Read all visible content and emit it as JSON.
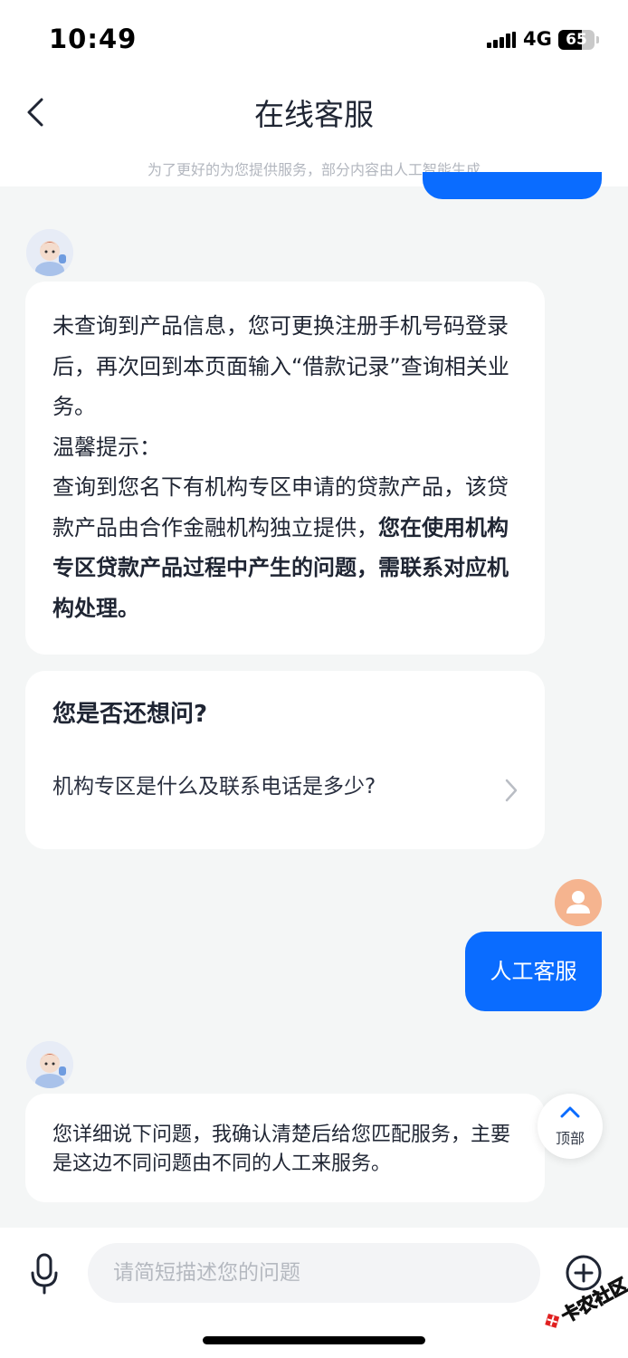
{
  "status_bar": {
    "time": "10:49",
    "network": "4G",
    "battery_percent": 65,
    "battery_label": "65"
  },
  "header": {
    "title": "在线客服",
    "subtitle": "为了更好的为您提供服务，部分内容由人工智能生成"
  },
  "messages": {
    "bot_reply_1": {
      "line_intro": "未查询到产品信息，您可更换注册手机号码登录后，再次回到本页面输入“借款记录”查询相关业务。",
      "tip_label": "温馨提示：",
      "tip_text": "查询到您名下有机构专区申请的贷款产品，该贷款产品由合作金融机构独立提供，",
      "tip_bold": "您在使用机构专区贷款产品过程中产生的问题，需联系对应机构处理。"
    },
    "suggestions": {
      "title": "您是否还想问?",
      "items": [
        "机构专区是什么及联系电话是多少?"
      ]
    },
    "user_message": "人工客服",
    "bot_reply_2": {
      "text": "您详细说下问题，我确认清楚后给您匹配服务，主要是这边不同问题由不同的人工来服务。"
    }
  },
  "top_button": {
    "label": "顶部"
  },
  "input_bar": {
    "placeholder": "请简短描述您的问题",
    "value": ""
  },
  "watermark": {
    "text": "卡农社区"
  },
  "colors": {
    "accent": "#0a6cff",
    "background": "#f4f6f6",
    "user_avatar": "#f5b48f"
  },
  "icons": [
    "chevron-left-icon",
    "chevron-right-icon",
    "chevron-up-icon",
    "microphone-icon",
    "plus-circle-icon",
    "bot-avatar",
    "user-avatar"
  ]
}
